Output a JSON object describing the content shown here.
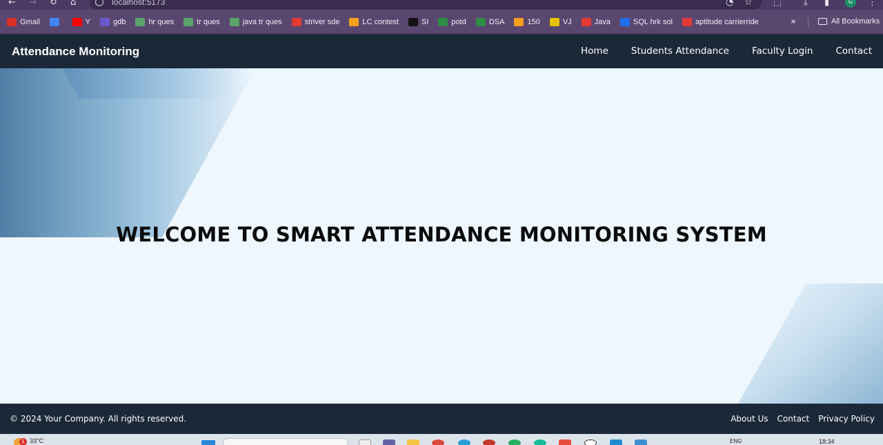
{
  "browser": {
    "url": "localhost:5173",
    "bookmarks": [
      {
        "label": "Gmail",
        "icon": "gmail-icon",
        "color": "#d93025"
      },
      {
        "label": "",
        "icon": "google-icon",
        "color": "#4285f4"
      },
      {
        "label": "Y",
        "icon": "youtube-icon",
        "color": "#ff0000"
      },
      {
        "label": "gdb",
        "icon": "gdb-icon",
        "color": "#6a5acd"
      },
      {
        "label": "hr ques",
        "icon": "mountain-icon",
        "color": "#5aa469"
      },
      {
        "label": "tr ques",
        "icon": "mountain-icon",
        "color": "#5aa469"
      },
      {
        "label": "java tr ques",
        "icon": "mountain-icon",
        "color": "#5aa469"
      },
      {
        "label": "striver sde",
        "icon": "striver-icon",
        "color": "#e53935"
      },
      {
        "label": "LC contest",
        "icon": "leetcode-icon",
        "color": "#f89f1b"
      },
      {
        "label": "SI",
        "icon": "ni-icon",
        "color": "#111111"
      },
      {
        "label": "potd",
        "icon": "gfg-icon",
        "color": "#2f8d46"
      },
      {
        "label": "DSA",
        "icon": "gfg-icon",
        "color": "#2f8d46"
      },
      {
        "label": "150",
        "icon": "leetcode-icon",
        "color": "#f89f1b"
      },
      {
        "label": "VJ",
        "icon": "vj-icon",
        "color": "#e6c200"
      },
      {
        "label": "Java",
        "icon": "java-icon",
        "color": "#e53935"
      },
      {
        "label": "SQL hrk sol",
        "icon": "sql-icon",
        "color": "#1f6feb"
      },
      {
        "label": "aptitude carrierride",
        "icon": "c-icon",
        "color": "#e53935"
      }
    ],
    "all_bookmarks_label": "All Bookmarks"
  },
  "navbar": {
    "brand": "Attendance Monitoring",
    "links": [
      "Home",
      "Students Attendance",
      "Faculty Login",
      "Contact"
    ]
  },
  "hero": {
    "title": "WELCOME TO SMART ATTENDANCE MONITORING SYSTEM"
  },
  "footer": {
    "copyright": "© 2024 Your Company. All rights reserved.",
    "links": [
      "About Us",
      "Contact",
      "Privacy Policy"
    ]
  },
  "taskbar": {
    "weather_badge": "1",
    "temperature": "33°C",
    "language": "ENG",
    "time": "18:34"
  },
  "colors": {
    "navbar_bg": "#1b2838",
    "main_bg": "#eef7fd",
    "accent_blue": "#4a7ea8"
  }
}
